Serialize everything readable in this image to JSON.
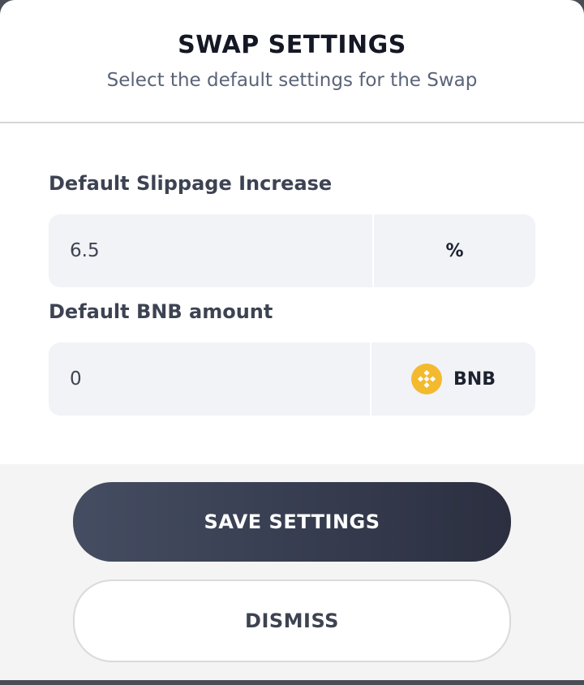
{
  "header": {
    "title": "SWAP SETTINGS",
    "subtitle": "Select the default settings for the Swap"
  },
  "slippage": {
    "label": "Default Slippage Increase",
    "value": "6.5",
    "unit": "%"
  },
  "bnb_amount": {
    "label": "Default BNB amount",
    "value": "0",
    "token": "BNB",
    "token_icon": "bnb-token-icon",
    "token_color": "#f3ba2f"
  },
  "actions": {
    "save_label": "SAVE SETTINGS",
    "dismiss_label": "DISMISS"
  }
}
